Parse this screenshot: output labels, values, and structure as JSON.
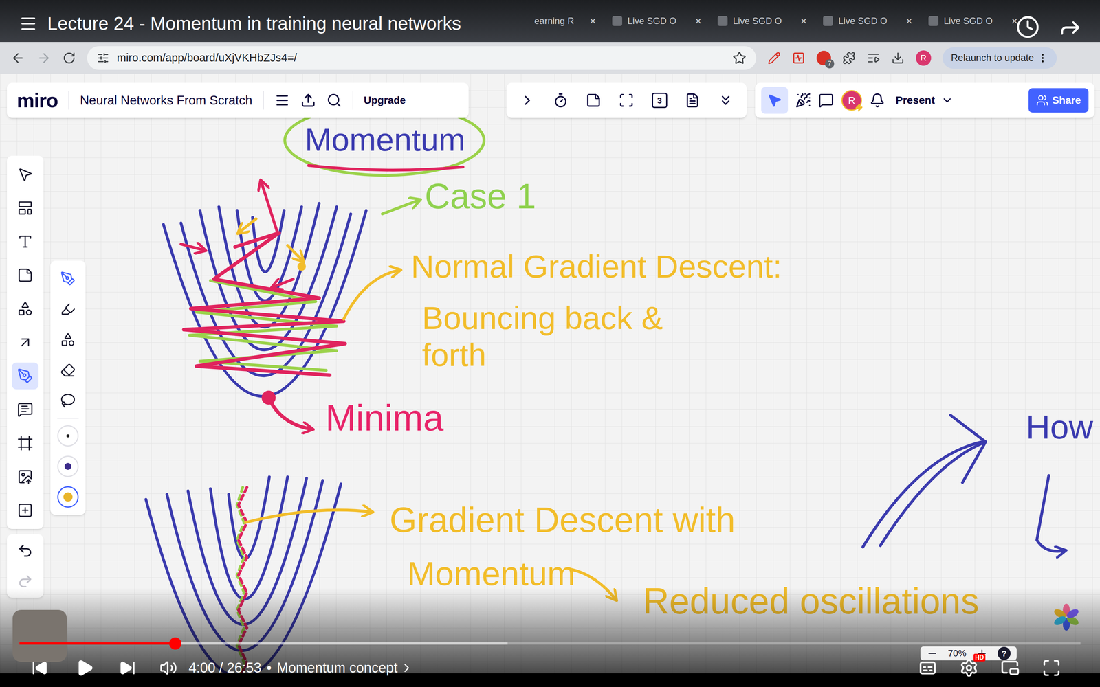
{
  "player": {
    "title": "Lecture 24 - Momentum in training neural networks",
    "time": "4:00 / 26:53",
    "chapter_separator": "•",
    "chapter": "Momentum concept",
    "progress": 0.147,
    "buffered": 0.46,
    "quality_badge": "HD"
  },
  "browser": {
    "tabs": [
      {
        "label": "earning R",
        "selected": false
      },
      {
        "label": "Live SGD O",
        "selected": false
      },
      {
        "label": "Live SGD O",
        "selected": false
      },
      {
        "label": "Live SGD O",
        "selected": false
      },
      {
        "label": "Live SGD O",
        "selected": false
      }
    ],
    "tab_close": "×",
    "url": "miro.com/app/board/uXjVKHbZJs4=/",
    "bookmarked": false,
    "extension_badge": "7",
    "profile_initial": "R",
    "relaunch": "Relaunch to update"
  },
  "miro": {
    "logo": "miro",
    "board_title": "Neural Networks From Scratch",
    "upgrade": "Upgrade",
    "counter": "3",
    "avatar_initial": "R",
    "present": "Present",
    "share": "Share",
    "zoom": "70%",
    "help": "?",
    "select_mode": true,
    "tools": [
      {
        "kind": "select",
        "selected": false
      },
      {
        "kind": "templates",
        "selected": false
      },
      {
        "kind": "text",
        "selected": false
      },
      {
        "kind": "sticky",
        "selected": false
      },
      {
        "kind": "shapes",
        "selected": false
      },
      {
        "kind": "connector",
        "selected": false
      },
      {
        "kind": "pen",
        "selected": true
      },
      {
        "kind": "comment",
        "selected": false
      },
      {
        "kind": "frame",
        "selected": false
      },
      {
        "kind": "upload",
        "selected": false
      },
      {
        "kind": "more",
        "selected": false
      }
    ],
    "pen_tools": [
      {
        "kind": "pen",
        "selected": true
      },
      {
        "kind": "marker",
        "selected": false
      },
      {
        "kind": "smart",
        "selected": false
      },
      {
        "kind": "eraser",
        "selected": false
      },
      {
        "kind": "lasso",
        "selected": false
      }
    ],
    "stroke_sizes": [
      {
        "kind": "thin",
        "color": "#222222",
        "selected": false
      },
      {
        "kind": "medium",
        "color": "#3b2a8a",
        "selected": false
      },
      {
        "kind": "thick",
        "color": "#e9b52c",
        "selected": true
      }
    ]
  },
  "canvas": {
    "labels": [
      {
        "text": "Momentum",
        "color": "#3b3bb0"
      },
      {
        "text": "Case 1",
        "color": "#8fd14f"
      },
      {
        "text": "Normal Gradient Descent:",
        "color": "#f2bd2a"
      },
      {
        "text": "Bouncing back & forth",
        "color": "#f2bd2a"
      },
      {
        "text": "Minima",
        "color": "#e8246a"
      },
      {
        "text": "Gradient Descent with",
        "color": "#f2bd2a"
      },
      {
        "text": "Momentum",
        "color": "#f2bd2a"
      },
      {
        "text": "Reduced oscillations",
        "color": "#f2bd2a"
      },
      {
        "text": "How",
        "color": "#3b3bb0"
      }
    ]
  }
}
